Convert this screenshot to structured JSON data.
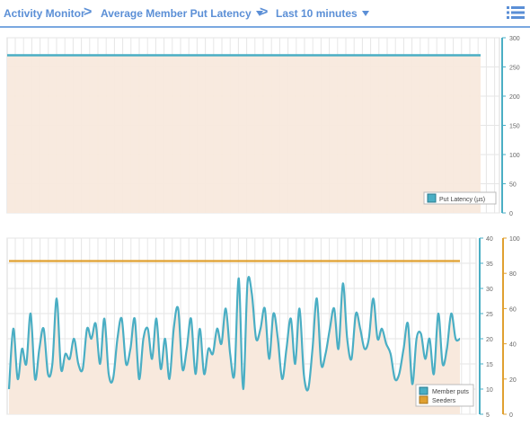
{
  "breadcrumb": {
    "items": [
      {
        "label": "Activity Monitor",
        "has_dropdown": false
      },
      {
        "label": "Average Member Put Latency",
        "has_dropdown": true
      },
      {
        "label": "Last 10 minutes",
        "has_dropdown": true
      }
    ],
    "separator": ">"
  },
  "colors": {
    "accent": "#5b8fd6",
    "teal": "#4aaec4",
    "orange": "#e0a030",
    "fill": "#f8e9dd"
  },
  "chart_data": [
    {
      "type": "line",
      "yaxis_right": {
        "ylim": [
          0,
          300
        ],
        "ticks": [
          "0",
          "50",
          "100",
          "150",
          "200",
          "250",
          "300"
        ]
      },
      "series": [
        {
          "name": "Put Latency (µs)",
          "color": "#4aaec4",
          "constant": 270
        }
      ],
      "legend_position": "bottom-right",
      "grid": true
    },
    {
      "type": "line",
      "yaxis_left": {
        "ylim": [
          5,
          40
        ],
        "ticks": [
          "5",
          "10",
          "15",
          "20",
          "25",
          "30",
          "35",
          "40"
        ]
      },
      "yaxis_right": {
        "ylim": [
          0,
          100
        ],
        "ticks": [
          "0",
          "20",
          "40",
          "60",
          "80",
          "100"
        ]
      },
      "series": [
        {
          "name": "Member puts",
          "color": "#4aaec4",
          "axis": "left",
          "values": [
            10,
            22,
            12,
            18,
            15,
            25,
            12,
            18,
            22,
            13,
            15,
            28,
            14,
            17,
            16,
            20,
            15,
            14,
            22,
            20,
            23,
            15,
            24,
            13,
            12,
            20,
            24,
            15,
            18,
            24,
            12,
            20,
            22,
            16,
            24,
            14,
            20,
            12,
            22,
            26,
            14,
            18,
            24,
            13,
            22,
            13,
            18,
            17,
            22,
            19,
            26,
            17,
            13,
            32,
            10,
            31,
            29,
            20,
            22,
            26,
            16,
            25,
            20,
            12,
            18,
            24,
            15,
            26,
            13,
            10,
            18,
            28,
            15,
            17,
            22,
            26,
            18,
            31,
            20,
            16,
            25,
            22,
            18,
            20,
            28,
            20,
            22,
            19,
            17,
            12,
            13,
            18,
            23,
            11,
            20,
            21,
            16,
            20,
            13,
            25,
            15,
            18,
            25,
            20,
            20
          ]
        },
        {
          "name": "Seeders",
          "color": "#e0a030",
          "axis": "right",
          "constant": 87
        }
      ],
      "legend_position": "bottom-right",
      "grid": true
    }
  ]
}
